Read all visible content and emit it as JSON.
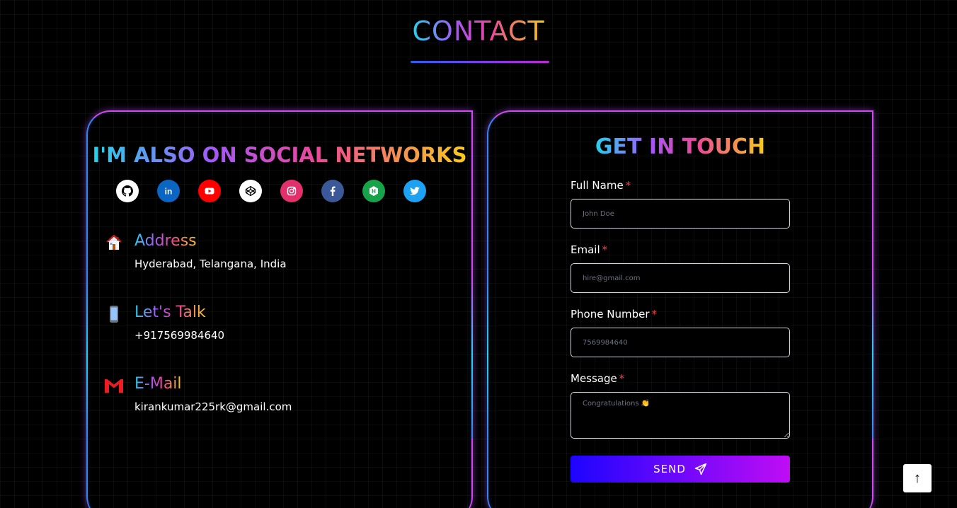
{
  "section": {
    "title": "CONTACT"
  },
  "social": {
    "heading": "I'M ALSO ON SOCIAL NETWORKS",
    "links": [
      {
        "name": "github",
        "icon": "github-icon",
        "bg": "#ffffff",
        "fg": "#000000"
      },
      {
        "name": "linkedin",
        "icon": "linkedin-icon",
        "bg": "#0a66c2",
        "fg": "#ffffff"
      },
      {
        "name": "youtube",
        "icon": "youtube-icon",
        "bg": "#ff0000",
        "fg": "#ffffff"
      },
      {
        "name": "codepen",
        "icon": "codepen-icon",
        "bg": "#ffffff",
        "fg": "#000000"
      },
      {
        "name": "instagram",
        "icon": "instagram-icon",
        "bg": "#e1306c",
        "fg": "#ffffff"
      },
      {
        "name": "facebook",
        "icon": "facebook-icon",
        "bg": "#3b5998",
        "fg": "#ffffff"
      },
      {
        "name": "hackerrank",
        "icon": "hackerrank-icon",
        "bg": "#16a34a",
        "fg": "#ffffff"
      },
      {
        "name": "twitter",
        "icon": "twitter-icon",
        "bg": "#1da1f2",
        "fg": "#ffffff"
      }
    ]
  },
  "info": {
    "address": {
      "label": "Address",
      "value": "Hyderabad, Telangana, India",
      "icon": "house-icon"
    },
    "talk": {
      "label": "Let's Talk",
      "value": "+917569984640",
      "icon": "phone-icon"
    },
    "email": {
      "label": "E-Mail",
      "value": "kirankumar225rk@gmail.com",
      "icon": "gmail-icon"
    }
  },
  "form": {
    "heading": "GET IN TOUCH",
    "required_mark": "*",
    "full_name": {
      "label": "Full Name",
      "placeholder": "John Doe"
    },
    "email": {
      "label": "Email",
      "placeholder": "hire@gmail.com"
    },
    "phone": {
      "label": "Phone Number",
      "placeholder": "7569984640"
    },
    "message": {
      "label": "Message",
      "placeholder": "Congratulations 👏"
    },
    "send_label": "SEND"
  },
  "scroll_top": {
    "label": "↑"
  },
  "colors": {
    "accent_start": "#1d04ff",
    "accent_end": "#c00cf5",
    "required": "#ef4444"
  }
}
